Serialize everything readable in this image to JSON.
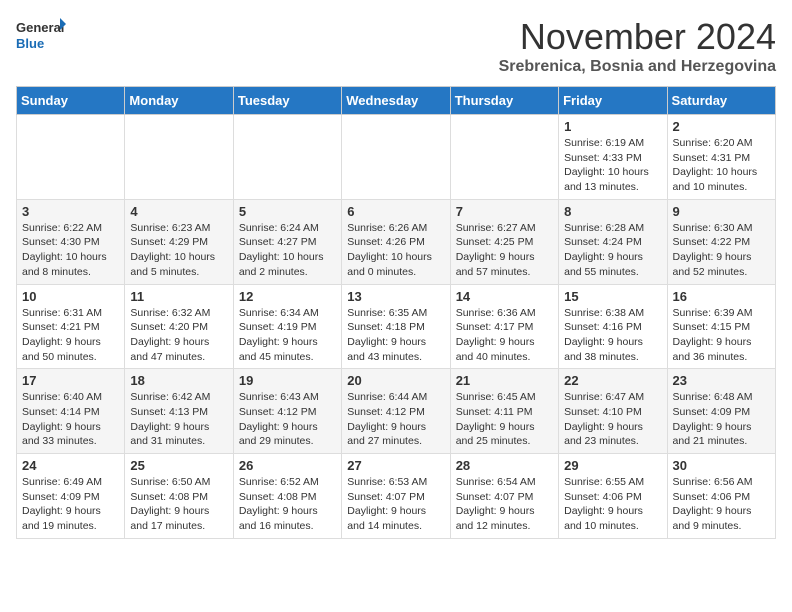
{
  "logo": {
    "general": "General",
    "blue": "Blue"
  },
  "title": "November 2024",
  "location": "Srebrenica, Bosnia and Herzegovina",
  "weekdays": [
    "Sunday",
    "Monday",
    "Tuesday",
    "Wednesday",
    "Thursday",
    "Friday",
    "Saturday"
  ],
  "weeks": [
    [
      {
        "day": "",
        "info": ""
      },
      {
        "day": "",
        "info": ""
      },
      {
        "day": "",
        "info": ""
      },
      {
        "day": "",
        "info": ""
      },
      {
        "day": "",
        "info": ""
      },
      {
        "day": "1",
        "info": "Sunrise: 6:19 AM\nSunset: 4:33 PM\nDaylight: 10 hours and 13 minutes."
      },
      {
        "day": "2",
        "info": "Sunrise: 6:20 AM\nSunset: 4:31 PM\nDaylight: 10 hours and 10 minutes."
      }
    ],
    [
      {
        "day": "3",
        "info": "Sunrise: 6:22 AM\nSunset: 4:30 PM\nDaylight: 10 hours and 8 minutes."
      },
      {
        "day": "4",
        "info": "Sunrise: 6:23 AM\nSunset: 4:29 PM\nDaylight: 10 hours and 5 minutes."
      },
      {
        "day": "5",
        "info": "Sunrise: 6:24 AM\nSunset: 4:27 PM\nDaylight: 10 hours and 2 minutes."
      },
      {
        "day": "6",
        "info": "Sunrise: 6:26 AM\nSunset: 4:26 PM\nDaylight: 10 hours and 0 minutes."
      },
      {
        "day": "7",
        "info": "Sunrise: 6:27 AM\nSunset: 4:25 PM\nDaylight: 9 hours and 57 minutes."
      },
      {
        "day": "8",
        "info": "Sunrise: 6:28 AM\nSunset: 4:24 PM\nDaylight: 9 hours and 55 minutes."
      },
      {
        "day": "9",
        "info": "Sunrise: 6:30 AM\nSunset: 4:22 PM\nDaylight: 9 hours and 52 minutes."
      }
    ],
    [
      {
        "day": "10",
        "info": "Sunrise: 6:31 AM\nSunset: 4:21 PM\nDaylight: 9 hours and 50 minutes."
      },
      {
        "day": "11",
        "info": "Sunrise: 6:32 AM\nSunset: 4:20 PM\nDaylight: 9 hours and 47 minutes."
      },
      {
        "day": "12",
        "info": "Sunrise: 6:34 AM\nSunset: 4:19 PM\nDaylight: 9 hours and 45 minutes."
      },
      {
        "day": "13",
        "info": "Sunrise: 6:35 AM\nSunset: 4:18 PM\nDaylight: 9 hours and 43 minutes."
      },
      {
        "day": "14",
        "info": "Sunrise: 6:36 AM\nSunset: 4:17 PM\nDaylight: 9 hours and 40 minutes."
      },
      {
        "day": "15",
        "info": "Sunrise: 6:38 AM\nSunset: 4:16 PM\nDaylight: 9 hours and 38 minutes."
      },
      {
        "day": "16",
        "info": "Sunrise: 6:39 AM\nSunset: 4:15 PM\nDaylight: 9 hours and 36 minutes."
      }
    ],
    [
      {
        "day": "17",
        "info": "Sunrise: 6:40 AM\nSunset: 4:14 PM\nDaylight: 9 hours and 33 minutes."
      },
      {
        "day": "18",
        "info": "Sunrise: 6:42 AM\nSunset: 4:13 PM\nDaylight: 9 hours and 31 minutes."
      },
      {
        "day": "19",
        "info": "Sunrise: 6:43 AM\nSunset: 4:12 PM\nDaylight: 9 hours and 29 minutes."
      },
      {
        "day": "20",
        "info": "Sunrise: 6:44 AM\nSunset: 4:12 PM\nDaylight: 9 hours and 27 minutes."
      },
      {
        "day": "21",
        "info": "Sunrise: 6:45 AM\nSunset: 4:11 PM\nDaylight: 9 hours and 25 minutes."
      },
      {
        "day": "22",
        "info": "Sunrise: 6:47 AM\nSunset: 4:10 PM\nDaylight: 9 hours and 23 minutes."
      },
      {
        "day": "23",
        "info": "Sunrise: 6:48 AM\nSunset: 4:09 PM\nDaylight: 9 hours and 21 minutes."
      }
    ],
    [
      {
        "day": "24",
        "info": "Sunrise: 6:49 AM\nSunset: 4:09 PM\nDaylight: 9 hours and 19 minutes."
      },
      {
        "day": "25",
        "info": "Sunrise: 6:50 AM\nSunset: 4:08 PM\nDaylight: 9 hours and 17 minutes."
      },
      {
        "day": "26",
        "info": "Sunrise: 6:52 AM\nSunset: 4:08 PM\nDaylight: 9 hours and 16 minutes."
      },
      {
        "day": "27",
        "info": "Sunrise: 6:53 AM\nSunset: 4:07 PM\nDaylight: 9 hours and 14 minutes."
      },
      {
        "day": "28",
        "info": "Sunrise: 6:54 AM\nSunset: 4:07 PM\nDaylight: 9 hours and 12 minutes."
      },
      {
        "day": "29",
        "info": "Sunrise: 6:55 AM\nSunset: 4:06 PM\nDaylight: 9 hours and 10 minutes."
      },
      {
        "day": "30",
        "info": "Sunrise: 6:56 AM\nSunset: 4:06 PM\nDaylight: 9 hours and 9 minutes."
      }
    ]
  ]
}
